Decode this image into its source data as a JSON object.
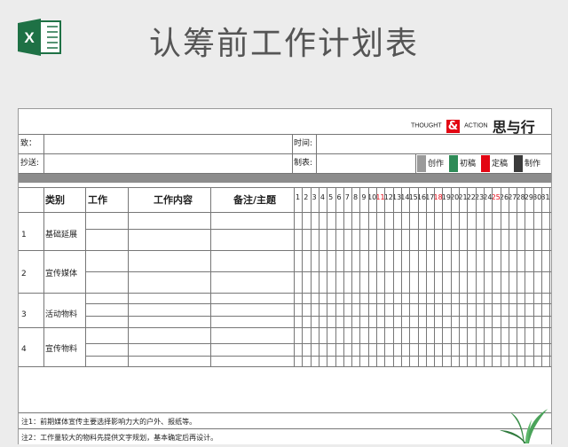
{
  "header": {
    "title": "认筹前工作计划表",
    "app_icon": "excel-icon",
    "app_letter": "X"
  },
  "brand": {
    "thought": "THOUGHT",
    "amp": "&",
    "action": "ACTION",
    "cn": "思与行"
  },
  "meta": {
    "to_label": "致：",
    "cc_label": "抄送:",
    "time_label": "时间:",
    "made_label": "制表:",
    "status": [
      {
        "label": "创作",
        "color": "#9a9a9a"
      },
      {
        "label": "初稿",
        "color": "#2e8b57"
      },
      {
        "label": "定稿",
        "color": "#e30613"
      },
      {
        "label": "制作",
        "color": "#3a3a3a"
      }
    ]
  },
  "table": {
    "headers": {
      "category": "类别",
      "work": "工作",
      "content": "工作内容",
      "remark": "备注/主题"
    },
    "days": [
      "1",
      "2",
      "3",
      "4",
      "5",
      "6",
      "7",
      "8",
      "9",
      "10",
      "11",
      "12",
      "13",
      "14",
      "15",
      "16",
      "17",
      "18",
      "19",
      "20",
      "21",
      "22",
      "23",
      "24",
      "25",
      "26",
      "27",
      "28",
      "29",
      "30",
      "31"
    ],
    "highlight_days": [
      "11",
      "18",
      "25"
    ],
    "highlight_color": "#e30613",
    "rows": [
      {
        "num": "1",
        "category": "基础延展"
      },
      {
        "num": "2",
        "category": "宣传媒体"
      },
      {
        "num": "3",
        "category": "活动物料"
      },
      {
        "num": "4",
        "category": "宣传物料"
      }
    ]
  },
  "notes": [
    "注1：前期媒体宣传主要选择影响力大的户外、报纸等。",
    "注2：工作量较大的物料先提供文字规划，基本确定后再设计。"
  ],
  "decor": {
    "plant": "plant-icon"
  }
}
